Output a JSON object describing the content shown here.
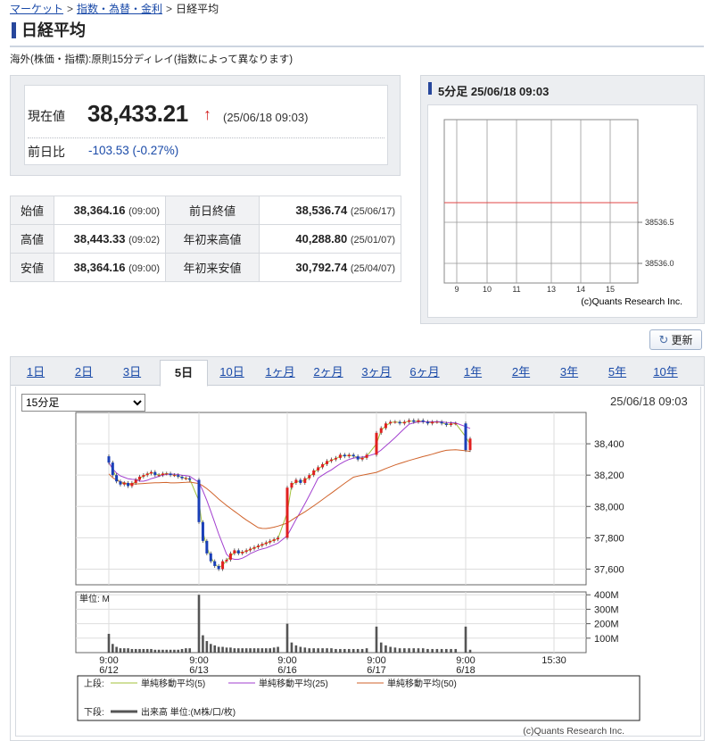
{
  "breadcrumb": {
    "market": "マーケット",
    "sep1": ">",
    "category": "指数・為替・金利",
    "sep2": ">",
    "current": "日経平均"
  },
  "page_title": "日経平均",
  "delay_note": "海外(株価・指標):原則15分ディレイ(指数によって異なります)",
  "quote": {
    "current_label": "現在値",
    "current_value": "38,433.21",
    "direction_arrow": "↑",
    "timestamp": "(25/06/18 09:03)",
    "change_label": "前日比",
    "change_value": "-103.53 (-0.27%)",
    "change_color": "#1a4aa8",
    "arrow_color": "#d21f1f"
  },
  "stats": [
    {
      "label1": "始値",
      "value1": "38,364.16",
      "time1": "(09:00)",
      "label2": "前日終値",
      "value2": "38,536.74",
      "time2": "(25/06/17)"
    },
    {
      "label1": "高値",
      "value1": "38,443.33",
      "time1": "(09:02)",
      "label2": "年初来高値",
      "value2": "40,288.80",
      "time2": "(25/01/07)"
    },
    {
      "label1": "安値",
      "value1": "38,364.16",
      "time1": "(09:00)",
      "label2": "年初来安値",
      "value2": "30,792.74",
      "time2": "(25/04/07)"
    }
  ],
  "mini_chart": {
    "title": "5分足 25/06/18 09:03",
    "x_ticks": [
      "9",
      "10",
      "11",
      "13",
      "14",
      "15"
    ],
    "y_ticks": [
      "38536.5",
      "38536.0"
    ],
    "prev_close_line": 38536.74,
    "credit": "(c)Quants Research Inc."
  },
  "refresh_label": "更新",
  "tabs": [
    "1日",
    "2日",
    "3日",
    "5日",
    "10日",
    "1ヶ月",
    "2ヶ月",
    "3ヶ月",
    "6ヶ月",
    "1年",
    "2年",
    "3年",
    "5年",
    "10年"
  ],
  "active_tab": "5日",
  "interval_select": {
    "value": "15分足"
  },
  "chart_timestamp": "25/06/18 09:03",
  "chart_data": {
    "type": "candlestick",
    "ylim": [
      37500,
      38600
    ],
    "y_ticks": [
      "38,400",
      "38,200",
      "38,000",
      "37,800",
      "37,600"
    ],
    "volume_unit_label": "単位: M",
    "volume_ticks": [
      "400M",
      "300M",
      "200M",
      "100M"
    ],
    "x_ticks": [
      {
        "time": "9:00",
        "date": "6/12"
      },
      {
        "time": "9:00",
        "date": "6/13"
      },
      {
        "time": "9:00",
        "date": "6/16"
      },
      {
        "time": "9:00",
        "date": "6/17"
      },
      {
        "time": "9:00",
        "date": "6/18"
      },
      {
        "time": "15:30",
        "date": ""
      }
    ],
    "close": [
      38280,
      38200,
      38160,
      38140,
      38150,
      38130,
      38150,
      38170,
      38190,
      38200,
      38210,
      38220,
      38200,
      38200,
      38210,
      38210,
      38200,
      38200,
      38190,
      38180,
      38180,
      38170,
      37900,
      37780,
      37700,
      37650,
      37620,
      37600,
      37650,
      37660,
      37700,
      37720,
      37700,
      37710,
      37720,
      37730,
      37740,
      37750,
      37760,
      37770,
      37780,
      37790,
      37800,
      38120,
      38150,
      38170,
      38150,
      38180,
      38200,
      38230,
      38250,
      38270,
      38290,
      38300,
      38310,
      38330,
      38320,
      38330,
      38320,
      38300,
      38310,
      38330,
      38470,
      38500,
      38530,
      38540,
      38540,
      38530,
      38540,
      38550,
      38540,
      38550,
      38540,
      38530,
      38540,
      38540,
      38530,
      38520,
      38530,
      38530,
      38360,
      38433
    ],
    "ma_lines": [
      {
        "name": "単純移動平均(5)",
        "color": "#a3c23a"
      },
      {
        "name": "単純移動平均(25)",
        "color": "#a23fcf"
      },
      {
        "name": "単純移動平均(50)",
        "color": "#d0632b"
      }
    ],
    "volume": [
      130,
      60,
      40,
      30,
      30,
      30,
      25,
      25,
      25,
      25,
      25,
      25,
      20,
      20,
      20,
      20,
      20,
      20,
      20,
      25,
      30,
      30,
      400,
      120,
      80,
      60,
      50,
      40,
      40,
      35,
      35,
      30,
      30,
      30,
      30,
      30,
      30,
      30,
      30,
      30,
      30,
      35,
      40,
      200,
      70,
      50,
      40,
      35,
      30,
      30,
      30,
      30,
      30,
      30,
      25,
      25,
      25,
      25,
      25,
      25,
      25,
      30,
      180,
      70,
      50,
      40,
      35,
      30,
      30,
      30,
      30,
      30,
      30,
      25,
      25,
      25,
      25,
      25,
      25,
      25,
      180,
      20
    ],
    "legend_upper_label": "上段:",
    "legend_lower_label": "下段:",
    "legend_volume": "出来高 単位:(M株/口/枚)",
    "credit": "(c)Quants Research Inc."
  }
}
